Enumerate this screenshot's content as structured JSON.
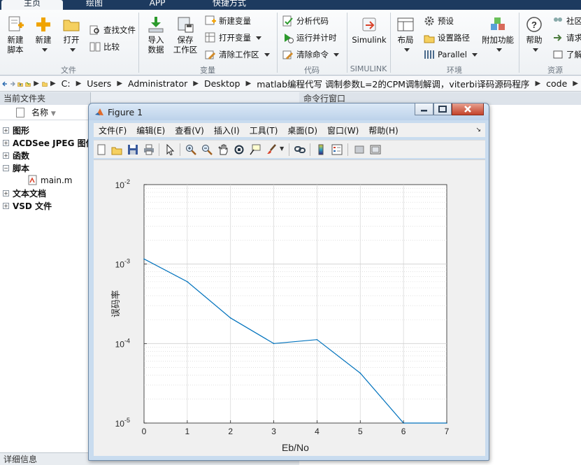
{
  "tabs": [
    {
      "label": "主页",
      "active": true
    },
    {
      "label": "绘图",
      "active": false
    },
    {
      "label": "APP",
      "active": false
    },
    {
      "label": "快捷方式",
      "active": false
    }
  ],
  "ribbon": {
    "file_group": {
      "new_script": "新建\n脚本",
      "new": "新建",
      "open": "打开",
      "find_files": "查找文件",
      "compare": "比较",
      "label": "文件"
    },
    "variable_group": {
      "import_data": "导入\n数据",
      "save_workspace": "保存\n工作区",
      "new_variable": "新建变量",
      "open_variable": "打开变量",
      "clear_workspace": "清除工作区",
      "label": "变量"
    },
    "code_group": {
      "analyze_code": "分析代码",
      "run_and_time": "运行并计时",
      "clear_commands": "清除命令",
      "label": "代码"
    },
    "simulink_group": {
      "simulink": "Simulink",
      "label": "SIMULINK"
    },
    "environment_group": {
      "layout": "布局",
      "preferences": "预设",
      "set_path": "设置路径",
      "parallel": "Parallel",
      "addons": "附加功能",
      "label": "环境"
    },
    "resources_group": {
      "help": "帮助",
      "community": "社区",
      "request_support": "请求",
      "learn": "了解",
      "label": "资源"
    }
  },
  "path": {
    "segments": [
      "C:",
      "Users",
      "Administrator",
      "Desktop",
      "matlab编程代写 调制参数L=2的CPM调制解调，viterbi译码源码程序",
      "code"
    ]
  },
  "left_panel": {
    "title": "当前文件夹",
    "column_header": "名称",
    "items": [
      {
        "label": "图形",
        "expanded": false
      },
      {
        "label": "ACDSee JPEG 图像",
        "expanded": false
      },
      {
        "label": "函数",
        "expanded": false
      },
      {
        "label": "脚本",
        "expanded": true
      },
      {
        "label": "文本文档",
        "expanded": false
      },
      {
        "label": "VSD 文件",
        "expanded": false
      }
    ],
    "script_child": "main.m",
    "footer": "详细信息"
  },
  "command_window": {
    "title": "命令行窗口"
  },
  "figure": {
    "title": "Figure 1",
    "menu": [
      "文件(F)",
      "编辑(E)",
      "查看(V)",
      "插入(I)",
      "工具(T)",
      "桌面(D)",
      "窗口(W)",
      "帮助(H)"
    ],
    "toolbar_icons": [
      "new-figure-icon",
      "open-file-icon",
      "save-icon",
      "print-icon",
      "pointer-icon",
      "zoom-in-icon",
      "zoom-out-icon",
      "pan-icon",
      "rotate-icon",
      "data-cursor-icon",
      "brush-icon",
      "link-icon",
      "colorbar-icon",
      "legend-icon",
      "hide-plot-tools-icon",
      "show-plot-tools-icon"
    ]
  },
  "chart_data": {
    "type": "line",
    "title": "",
    "xlabel": "Eb/No",
    "ylabel": "误码率",
    "xlim": [
      0,
      7
    ],
    "ylim_log10": [
      -5,
      -2
    ],
    "yscale": "log",
    "grid": true,
    "x_ticks": [
      "0",
      "1",
      "2",
      "3",
      "4",
      "5",
      "6",
      "7"
    ],
    "y_ticks": [
      {
        "base": "10",
        "exp": "-5"
      },
      {
        "base": "10",
        "exp": "-4"
      },
      {
        "base": "10",
        "exp": "-3"
      },
      {
        "base": "10",
        "exp": "-2"
      }
    ],
    "series": [
      {
        "color": "#0072bd",
        "x": [
          0,
          1,
          2,
          3,
          4,
          5,
          6,
          7
        ],
        "y": [
          0.00116,
          0.0006,
          0.00021,
          0.0001,
          0.000112,
          4.25e-05,
          1e-05,
          1e-05
        ]
      }
    ]
  }
}
